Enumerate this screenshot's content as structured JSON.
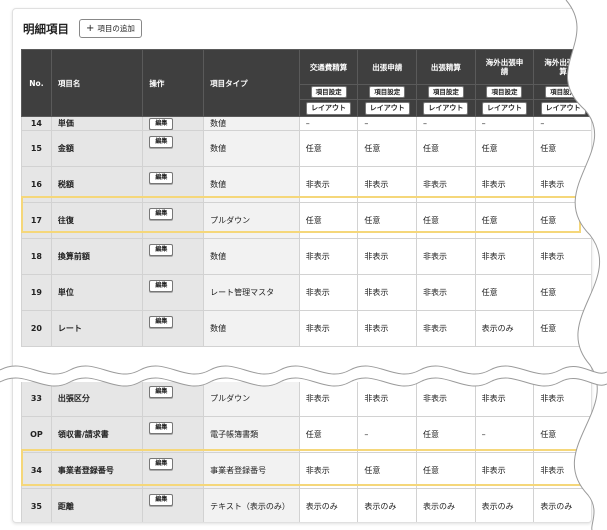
{
  "section": {
    "title": "明細項目",
    "add_button": "項目の追加",
    "add_icon": "plus-icon"
  },
  "table": {
    "headers": {
      "no": "No.",
      "name": "項目名",
      "op": "操作",
      "type": "項目タイプ",
      "patterns": [
        "交通費精算",
        "出張申請",
        "出張精算",
        "海外出張申請",
        "海外出張精算"
      ],
      "settings_button": "項目設定",
      "layout_button": "レイアウト"
    },
    "edit_label": "編集",
    "rows_top": [
      {
        "no": "14",
        "name": "単価",
        "type": "数値",
        "values": [
          "–",
          "–",
          "–",
          "–",
          "–"
        ]
      },
      {
        "no": "15",
        "name": "金額",
        "type": "数値",
        "values": [
          "任意",
          "任意",
          "任意",
          "任意",
          "任意"
        ]
      },
      {
        "no": "16",
        "name": "税額",
        "type": "数値",
        "values": [
          "非表示",
          "非表示",
          "非表示",
          "非表示",
          "非表示"
        ]
      },
      {
        "no": "17",
        "name": "往復",
        "type": "プルダウン",
        "values": [
          "任意",
          "任意",
          "任意",
          "任意",
          "任意"
        ]
      },
      {
        "no": "18",
        "name": "換算前額",
        "type": "数値",
        "values": [
          "非表示",
          "非表示",
          "非表示",
          "非表示",
          "非表示"
        ]
      },
      {
        "no": "19",
        "name": "単位",
        "type": "レート管理マスタ",
        "values": [
          "非表示",
          "非表示",
          "非表示",
          "任意",
          "任意"
        ]
      },
      {
        "no": "20",
        "name": "レート",
        "type": "数値",
        "values": [
          "非表示",
          "非表示",
          "非表示",
          "表示のみ",
          "任意"
        ]
      }
    ],
    "rows_bottom": [
      {
        "no": "33",
        "name": "出張区分",
        "type": "プルダウン",
        "values": [
          "非表示",
          "非表示",
          "非表示",
          "非表示",
          "非表示"
        ]
      },
      {
        "no": "OP",
        "name": "領収書/請求書",
        "type": "電子帳簿書類",
        "values": [
          "任意",
          "–",
          "任意",
          "–",
          "任意"
        ]
      },
      {
        "no": "34",
        "name": "事業者登録番号",
        "type": "事業者登録番号",
        "values": [
          "非表示",
          "任意",
          "任意",
          "非表示",
          "非表示"
        ]
      },
      {
        "no": "35",
        "name": "距離",
        "type": "テキスト（表示のみ）",
        "values": [
          "表示のみ",
          "表示のみ",
          "表示のみ",
          "表示のみ",
          "表示のみ"
        ]
      }
    ]
  },
  "colors": {
    "header_bg": "#3f3f3f",
    "highlight": "#f5d77a",
    "fixed_col_bg": "#e6e6e6"
  }
}
